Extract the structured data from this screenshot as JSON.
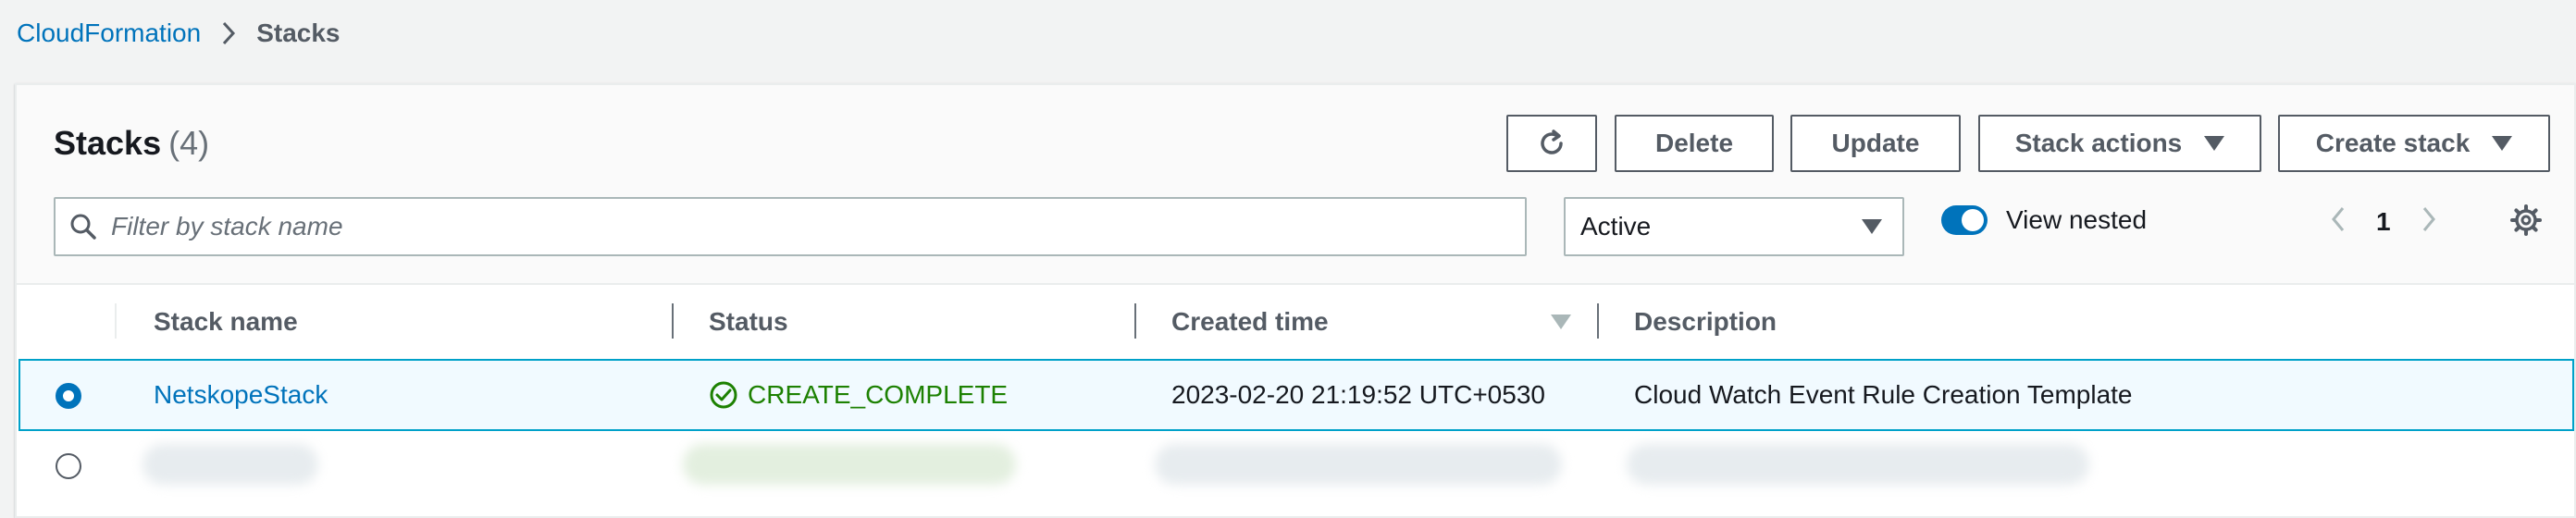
{
  "breadcrumb": {
    "root": "CloudFormation",
    "current": "Stacks"
  },
  "header": {
    "title": "Stacks",
    "count": "(4)"
  },
  "toolbar": {
    "refresh_icon": "refresh-icon",
    "delete_label": "Delete",
    "update_label": "Update",
    "stack_actions_label": "Stack actions",
    "create_stack_label": "Create stack"
  },
  "filter": {
    "placeholder": "Filter by stack name",
    "status_select": "Active",
    "view_nested_label": "View nested",
    "view_nested_on": true
  },
  "pagination": {
    "page": "1"
  },
  "table": {
    "columns": {
      "name": "Stack name",
      "status": "Status",
      "created": "Created time",
      "description": "Description"
    },
    "rows": [
      {
        "name": "NetskopeStack",
        "status": "CREATE_COMPLETE",
        "created": "2023-02-20 21:19:52 UTC+0530",
        "description": "Cloud Watch Event Rule Creation Template",
        "selected": true
      }
    ]
  },
  "colors": {
    "link": "#0073bb",
    "success": "#1d8102",
    "selected_row_bg": "#f1faff",
    "selected_row_border": "#00a1c9"
  }
}
